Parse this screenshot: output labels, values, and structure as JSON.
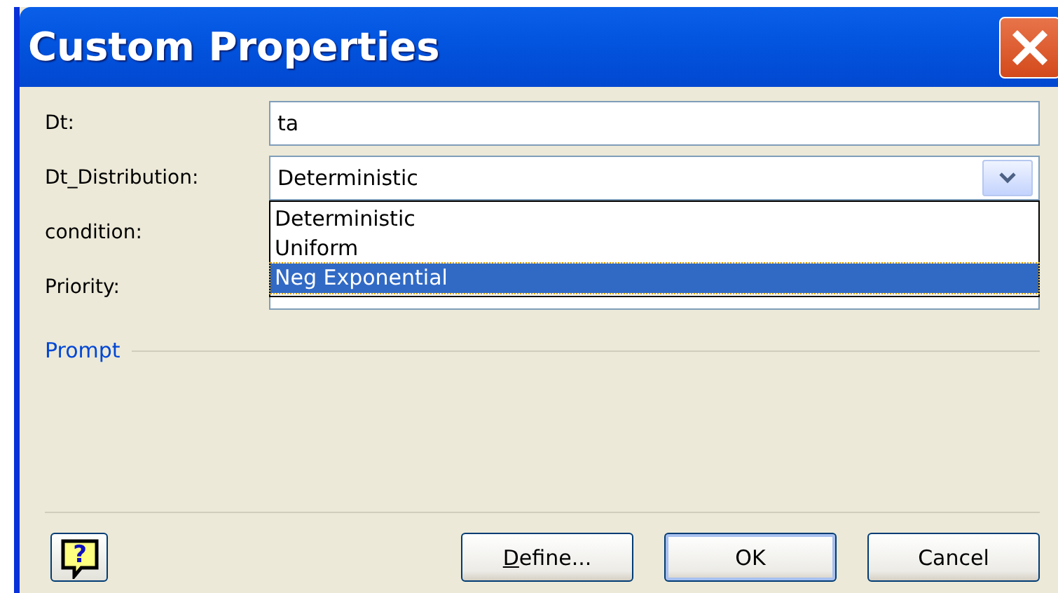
{
  "window": {
    "title": "Custom Properties"
  },
  "fields": [
    {
      "label": "Dt:",
      "kind": "text",
      "value": "ta"
    },
    {
      "label": "Dt_Distribution:",
      "kind": "dropdown",
      "value": "Deterministic",
      "open": true,
      "options": [
        {
          "label": "Deterministic",
          "highlighted": false
        },
        {
          "label": "Uniform",
          "highlighted": false
        },
        {
          "label": "Neg Exponential",
          "highlighted": true
        }
      ]
    },
    {
      "label": "condition:",
      "kind": "covered"
    },
    {
      "label": "Priority:",
      "kind": "text"
    }
  ],
  "section": "Prompt",
  "help_button": "?",
  "buttons": [
    "Define...",
    "OK",
    "Cancel"
  ]
}
